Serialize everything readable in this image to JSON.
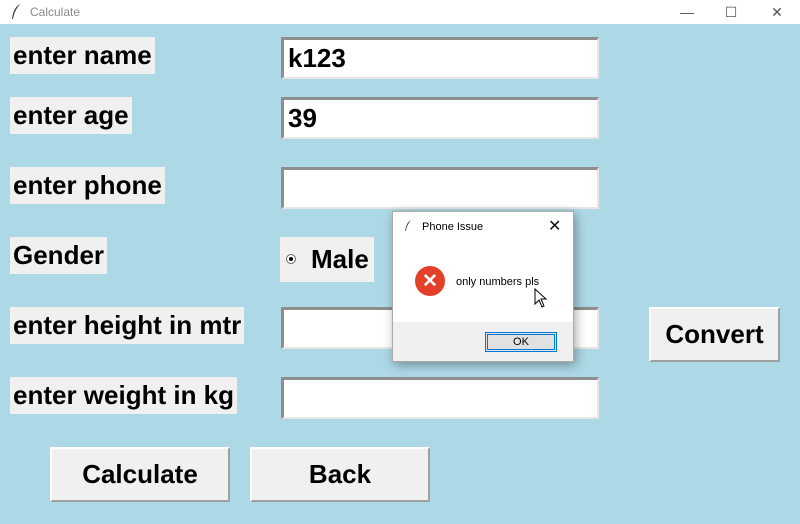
{
  "window": {
    "title": "Calculate",
    "minimize": "—",
    "maximize": "☐",
    "close": "✕"
  },
  "form": {
    "name_label": "enter name",
    "name_value": "k123",
    "age_label": "enter age",
    "age_value": "39",
    "phone_label": "enter phone",
    "phone_value": "",
    "gender_label": "Gender",
    "gender_option": "Male",
    "height_label": "enter height in mtr",
    "height_value": "",
    "weight_label": "enter weight in kg",
    "weight_value": ""
  },
  "buttons": {
    "convert": "Convert",
    "calculate": "Calculate",
    "back": "Back"
  },
  "dialog": {
    "title": "Phone Issue",
    "message": "only numbers pls",
    "ok": "OK",
    "close": "✕",
    "icon": "error-icon"
  }
}
